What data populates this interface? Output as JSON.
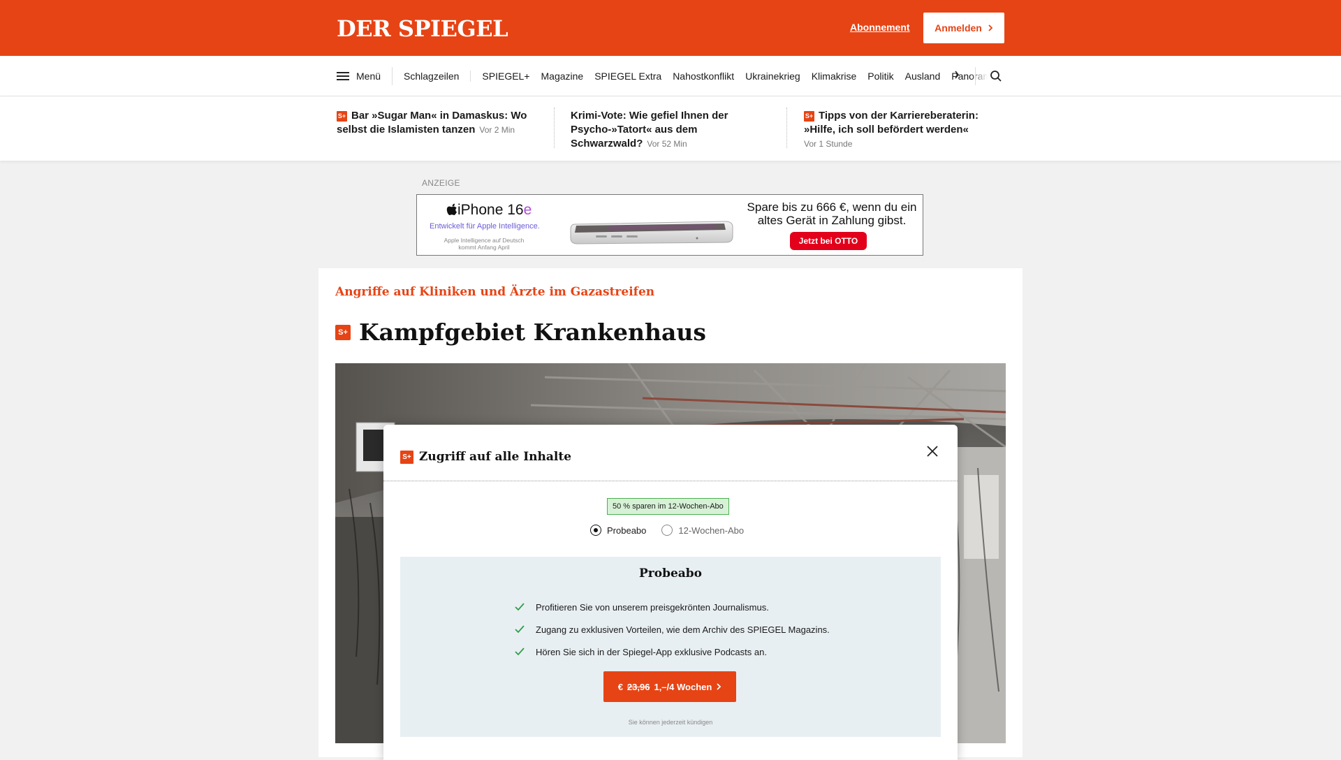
{
  "header": {
    "logo": "DER SPIEGEL",
    "abo_link": "Abonnement",
    "login_label": "Anmelden",
    "brand_color": "#e64415"
  },
  "nav": {
    "menu_label": "Menü",
    "items": [
      "Schlagzeilen",
      "SPIEGEL+",
      "Magazine",
      "SPIEGEL Extra",
      "Nahostkonflikt",
      "Ukrainekrieg",
      "Klimakrise",
      "Politik",
      "Ausland"
    ],
    "overflow_item": "Panorama",
    "icons": [
      "hamburger-icon",
      "chevron-right-icon",
      "search-icon"
    ]
  },
  "headlines": [
    {
      "badge": "S+",
      "title": "Bar »Sugar Man« in Damaskus: Wo selbst die Islamisten tanzen",
      "time": "Vor 2 Min",
      "plus": true
    },
    {
      "badge": "",
      "title": "Krimi-Vote: Wie gefiel Ihnen der Psycho-»Tatort« aus dem Schwarzwald?",
      "time": "Vor 52 Min",
      "plus": false
    },
    {
      "badge": "S+",
      "title": "Tipps von der Karriereberaterin: »Hilfe, ich soll befördert werden«",
      "time": "Vor 1 Stunde",
      "plus": true
    }
  ],
  "ad": {
    "label": "ANZEIGE",
    "brand_prefix": "iPhone 16",
    "brand_suffix": "e",
    "subline": "Entwickelt für Apple Intelligence.",
    "note": "Apple Intelligence auf Deutsch kommt Anfang April",
    "offer": "Spare bis zu 666 €, wenn du ein altes Gerät in Zahlung gibst.",
    "cta": "Jetzt bei OTTO"
  },
  "article": {
    "kicker": "Angriffe auf Kliniken und Ärzte im Gazastreifen",
    "badge": "S+",
    "title": "Kampfgebiet Krankenhaus"
  },
  "modal": {
    "badge": "S+",
    "title": "Zugriff auf alle Inhalte",
    "save_badge": "50 % sparen im 12-Wochen-Abo",
    "options": [
      {
        "label": "Probeabo",
        "selected": true
      },
      {
        "label": "12-Wochen-Abo",
        "selected": false
      }
    ],
    "plan_title": "Probeabo",
    "benefits": [
      "Profitieren Sie von unserem preisgekrönten Journalismus.",
      "Zugang zu exklusiven Vorteilen, wie dem Archiv des SPIEGEL Magazins.",
      "Hören Sie sich in der Spiegel-App exklusive Podcasts an."
    ],
    "cta_currency": "€",
    "cta_old_price": "23,96",
    "cta_new_price": "1,–/4 Wochen",
    "cancel_note": "Sie können jederzeit kündigen"
  }
}
